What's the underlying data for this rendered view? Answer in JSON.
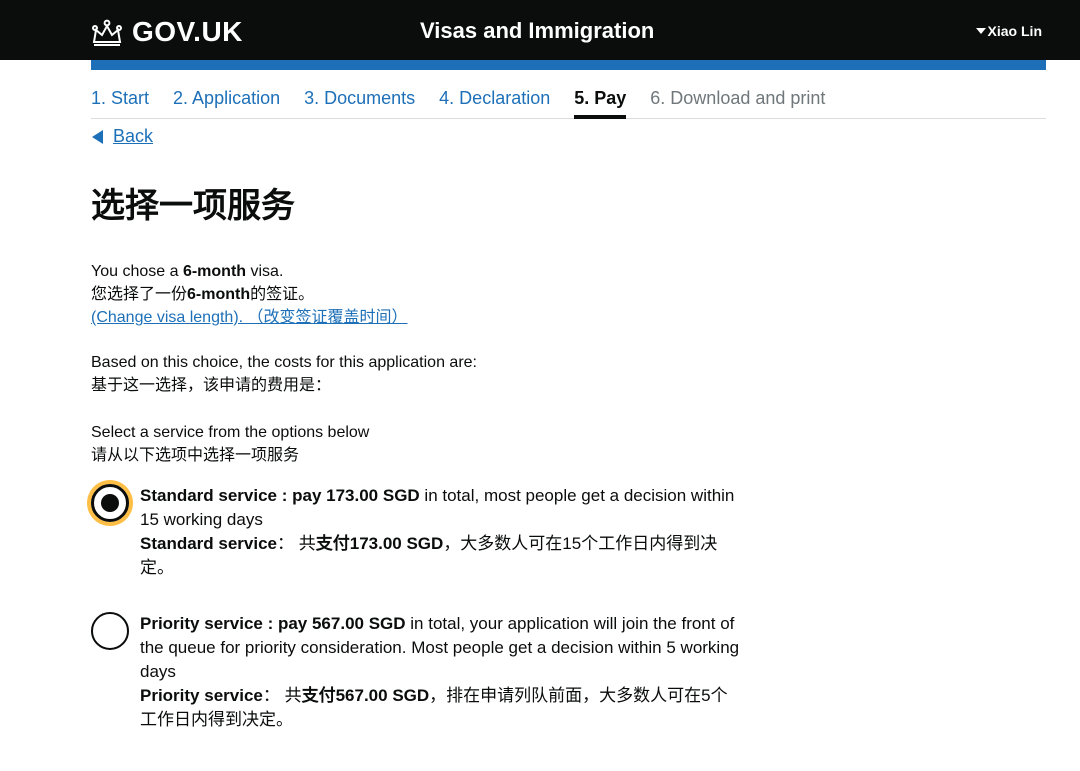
{
  "header": {
    "logo_text": "GOV.UK",
    "service_name": "Visas and Immigration",
    "user_name": "Xiao Lin"
  },
  "steps": [
    {
      "label": "1. Start"
    },
    {
      "label": "2. Application"
    },
    {
      "label": "3. Documents"
    },
    {
      "label": "4. Declaration"
    },
    {
      "label": "5. Pay"
    },
    {
      "label": "6. Download and print"
    }
  ],
  "back_link": "Back",
  "page_title": "选择一项服务",
  "visa_choice": {
    "line1_prefix": "You chose a ",
    "line1_bold": "6-month",
    "line1_suffix": " visa.",
    "line2_prefix": "您选择了一份",
    "line2_bold": "6-month",
    "line2_suffix": "的签证。",
    "change_link": "(Change visa length). （改变签证覆盖时间）"
  },
  "costs_intro": {
    "en": "Based on this choice, the costs for this application are:",
    "zh": "基于这一选择，该申请的费用是："
  },
  "select_intro": {
    "en": "Select a service from the options below",
    "zh": "请从以下选项中选择一项服务"
  },
  "services": [
    {
      "checked": true,
      "en_bold": "Standard service : pay 173.00 SGD",
      "en_rest": " in total, most people get a decision within 15 working days",
      "zh_bold1": "Standard service",
      "zh_mid": "：  共",
      "zh_bold2": "支付173.00 SGD",
      "zh_rest": "，大多数人可在15个工作日内得到决定。"
    },
    {
      "checked": false,
      "en_bold": "Priority service : pay 567.00 SGD",
      "en_rest": " in total, your application will join the front of the queue for priority consideration. Most people get a decision within 5 working days",
      "zh_bold1": "Priority service",
      "zh_mid": "：  共",
      "zh_bold2": "支付567.00 SGD",
      "zh_rest": "，排在申请列队前面，大多数人可在5个工作日内得到决定。"
    }
  ],
  "colors": {
    "header_bg": "#0b0c0c",
    "link_blue": "#1d70b8",
    "focus_yellow": "#ffbf47"
  }
}
